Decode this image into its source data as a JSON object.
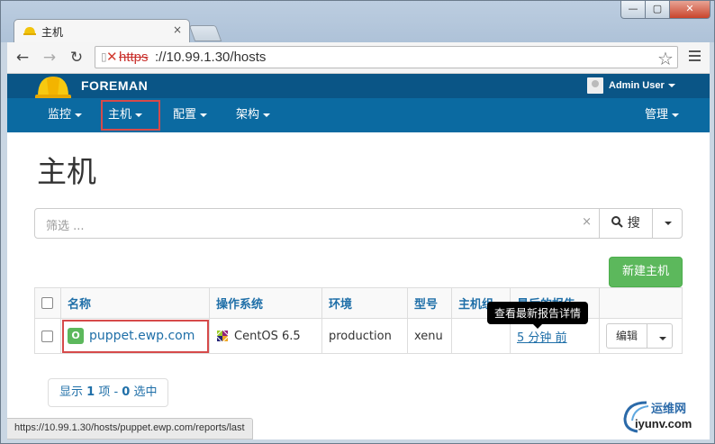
{
  "browser": {
    "tab_title": "主机",
    "tab_close": "×",
    "window_min": "—",
    "window_max": "▢",
    "window_close": "✕",
    "back_icon": "arrow-left-icon",
    "address_scheme": "https",
    "address_rest": "://10.99.1.30/hosts",
    "status_url": "https://10.99.1.30/hosts/puppet.ewp.com/reports/last"
  },
  "app": {
    "brand": "FOREMAN",
    "user": "Admin User",
    "nav": [
      {
        "label": "监控"
      },
      {
        "label": "主机"
      },
      {
        "label": "配置"
      },
      {
        "label": "架构"
      }
    ],
    "admin_menu": "管理"
  },
  "page": {
    "title": "主机",
    "search_placeholder": "筛选 ...",
    "search_clear": "×",
    "search_button": "搜",
    "new_host_button": "新建主机",
    "table": {
      "headers": [
        "名称",
        "操作系统",
        "环境",
        "型号",
        "主机组",
        "最后的报告"
      ],
      "rows": [
        {
          "status": "O",
          "name": "puppet.ewp.com",
          "os": "CentOS 6.5",
          "environment": "production",
          "model": "xenu",
          "hostgroup": "",
          "last_report": "5 分钟 前",
          "edit": "编辑"
        }
      ]
    },
    "tooltip": "查看最新报告详情",
    "pager": {
      "prefix": "显示 ",
      "shown": "1",
      "mid": " 项 - ",
      "selected": "0",
      "suffix": " 选中"
    }
  },
  "watermark": {
    "line1": "运维网",
    "line2": "iyunv.com"
  },
  "colors": {
    "navbar_top": "#0a5586",
    "navbar": "#0b6aa1",
    "success": "#5cb85c",
    "link": "#1f6fa8",
    "highlight": "#d64a4a"
  }
}
